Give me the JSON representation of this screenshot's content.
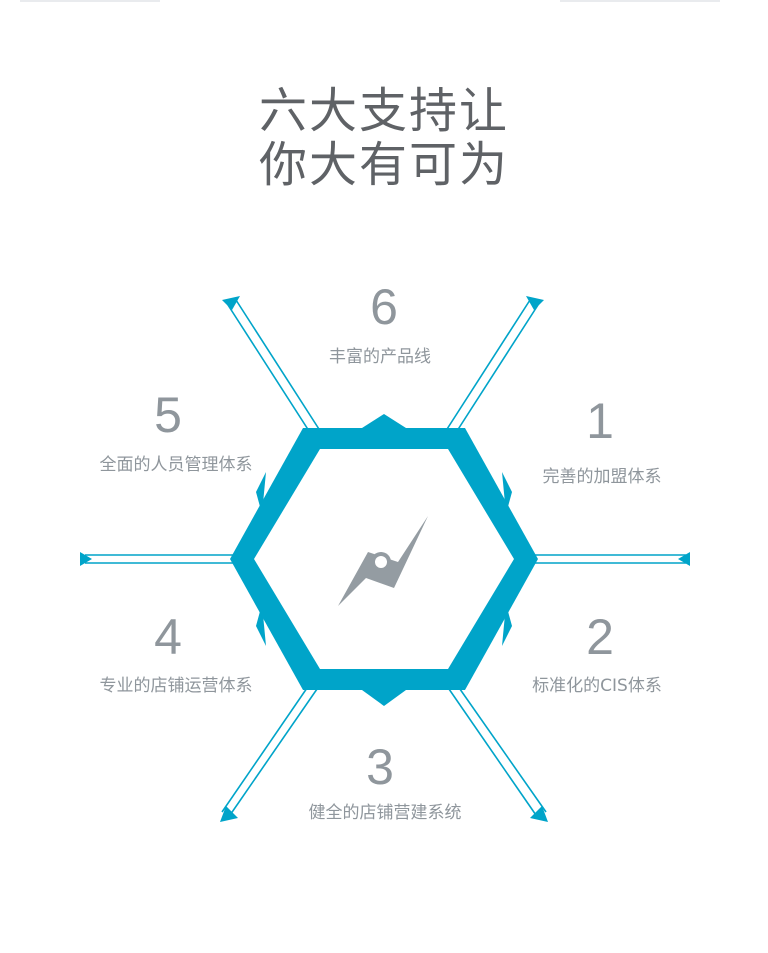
{
  "title": {
    "line1": "六大支持让",
    "line2": "你大有可为"
  },
  "colors": {
    "accent": "#00a4c9",
    "title": "#5f6266",
    "label": "#8f969c",
    "compass": "#949ca2"
  },
  "center_icon": "compass-icon",
  "nodes": [
    {
      "number": "1",
      "label": "完善的加盟体系"
    },
    {
      "number": "2",
      "label": "标准化的CIS体系"
    },
    {
      "number": "3",
      "label": "健全的店铺营建系统"
    },
    {
      "number": "4",
      "label": "专业的店铺运营体系"
    },
    {
      "number": "5",
      "label": "全面的人员管理体系"
    },
    {
      "number": "6",
      "label": "丰富的产品线"
    }
  ]
}
